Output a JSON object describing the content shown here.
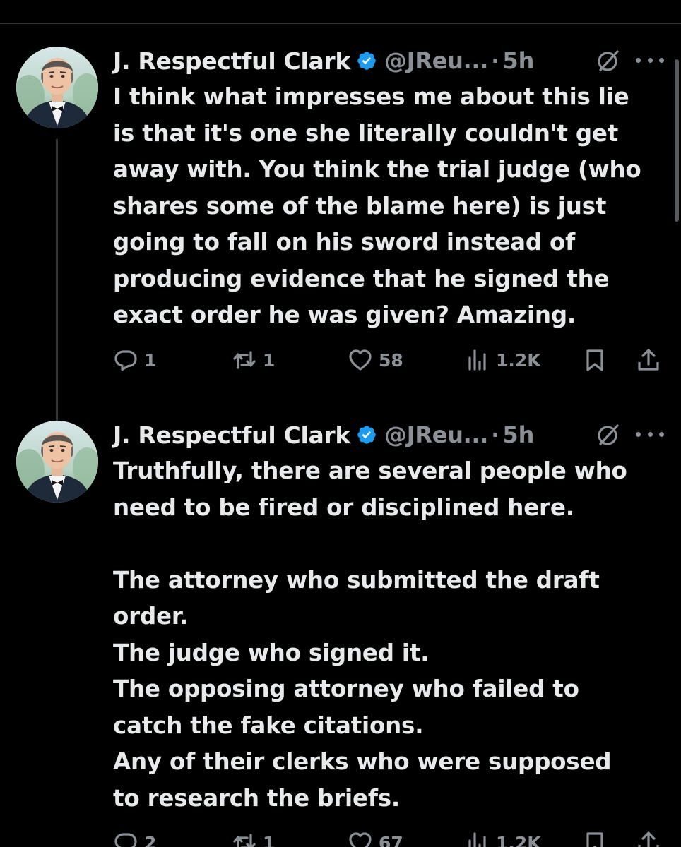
{
  "tweets": [
    {
      "display_name": "J. Respectful Clark",
      "handle": "@JReu...",
      "separator": "·",
      "time": "5h",
      "text": "I think what impresses me about this lie\nis that it's one she literally couldn't get\naway with. You think the trial judge (who\nshares some of the blame here) is just\ngoing to fall on his sword instead of\nproducing evidence that he signed the\nexact order he was given? Amazing.",
      "replies": "1",
      "reposts": "1",
      "likes": "58",
      "views": "1.2K"
    },
    {
      "display_name": "J. Respectful Clark",
      "handle": "@JReu...",
      "separator": "·",
      "time": "5h",
      "text": "Truthfully, there are several people who\nneed to be fired or disciplined here.\n\nThe attorney who submitted the draft\norder.\nThe judge who signed it.\nThe opposing attorney who failed to\ncatch the fake citations.\nAny of their clerks who were supposed\nto research the briefs.",
      "replies": "2",
      "reposts": "1",
      "likes": "67",
      "views": "1.2K"
    }
  ],
  "colors": {
    "background": "#000000",
    "text_primary": "#e7e9ea",
    "text_secondary": "#8b9096",
    "verified_badge": "#1d9bf0",
    "divider": "#2f3336"
  },
  "icons": [
    "verified-badge-icon",
    "grok-icon",
    "more-icon",
    "reply-icon",
    "repost-icon",
    "like-icon",
    "views-icon",
    "bookmark-icon",
    "share-icon"
  ]
}
